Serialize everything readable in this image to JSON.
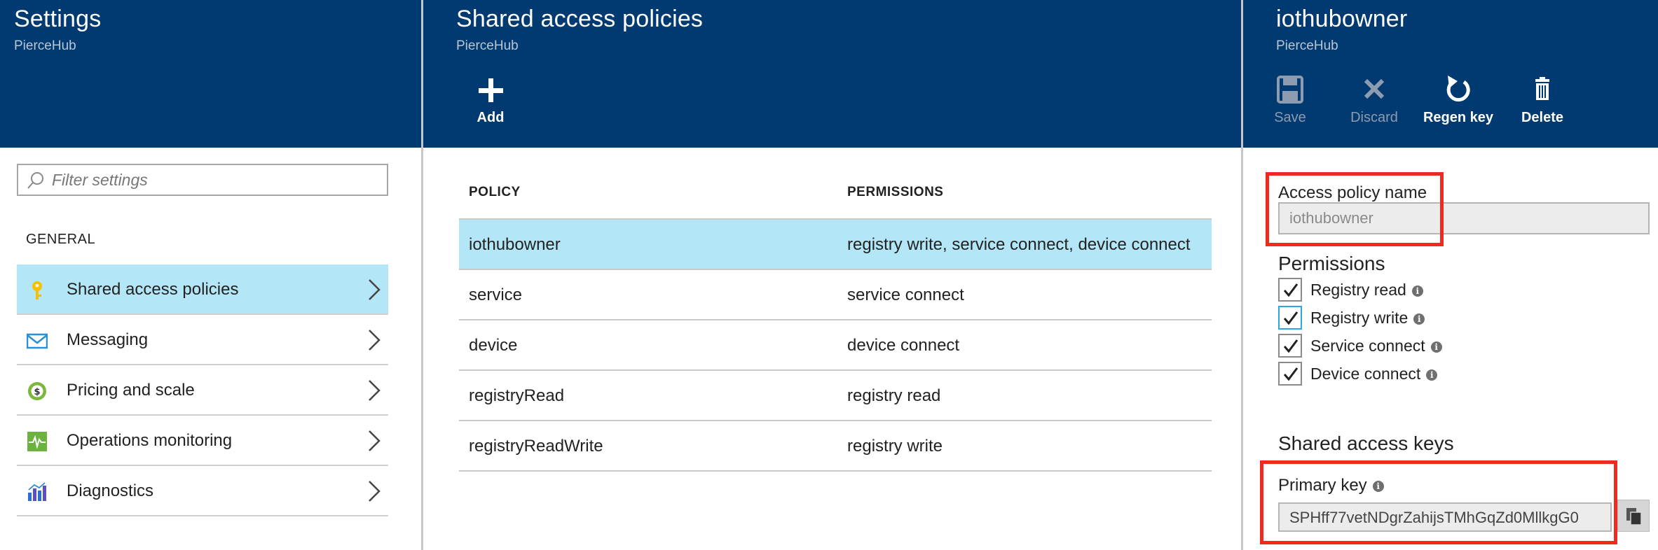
{
  "settings_blade": {
    "title": "Settings",
    "subtitle": "PierceHub",
    "filter_placeholder": "Filter settings",
    "section": "GENERAL",
    "items": [
      {
        "label": "Shared access policies",
        "icon": "key-icon",
        "active": true
      },
      {
        "label": "Messaging",
        "icon": "envelope-icon",
        "active": false
      },
      {
        "label": "Pricing and scale",
        "icon": "pricing-icon",
        "active": false
      },
      {
        "label": "Operations monitoring",
        "icon": "monitor-pulse-icon",
        "active": false
      },
      {
        "label": "Diagnostics",
        "icon": "bar-chart-icon",
        "active": false
      }
    ]
  },
  "policies_blade": {
    "title": "Shared access policies",
    "subtitle": "PierceHub",
    "add_label": "Add",
    "columns": [
      "POLICY",
      "PERMISSIONS"
    ],
    "rows": [
      {
        "policy": "iothubowner",
        "permissions": "registry write, service connect, device connect",
        "selected": true
      },
      {
        "policy": "service",
        "permissions": "service connect",
        "selected": false
      },
      {
        "policy": "device",
        "permissions": "device connect",
        "selected": false
      },
      {
        "policy": "registryRead",
        "permissions": "registry read",
        "selected": false
      },
      {
        "policy": "registryReadWrite",
        "permissions": "registry write",
        "selected": false
      }
    ]
  },
  "detail_blade": {
    "title": "iothubowner",
    "subtitle": "PierceHub",
    "commands": {
      "save": "Save",
      "discard": "Discard",
      "regen": "Regen key",
      "delete": "Delete"
    },
    "policy_name_label": "Access policy name",
    "policy_name_value": "iothubowner",
    "permissions_title": "Permissions",
    "permissions": [
      {
        "label": "Registry read",
        "checked": true
      },
      {
        "label": "Registry write",
        "checked": true
      },
      {
        "label": "Service connect",
        "checked": true
      },
      {
        "label": "Device connect",
        "checked": true
      }
    ],
    "keys_title": "Shared access keys",
    "primary_key_label": "Primary key",
    "primary_key_value": "SPHff77vetNDgrZahijsTMhGqZd0MllkgG0"
  },
  "colors": {
    "header": "#003a70",
    "selected_row": "#b3e7f7",
    "highlight_box": "#ef2a1f"
  }
}
